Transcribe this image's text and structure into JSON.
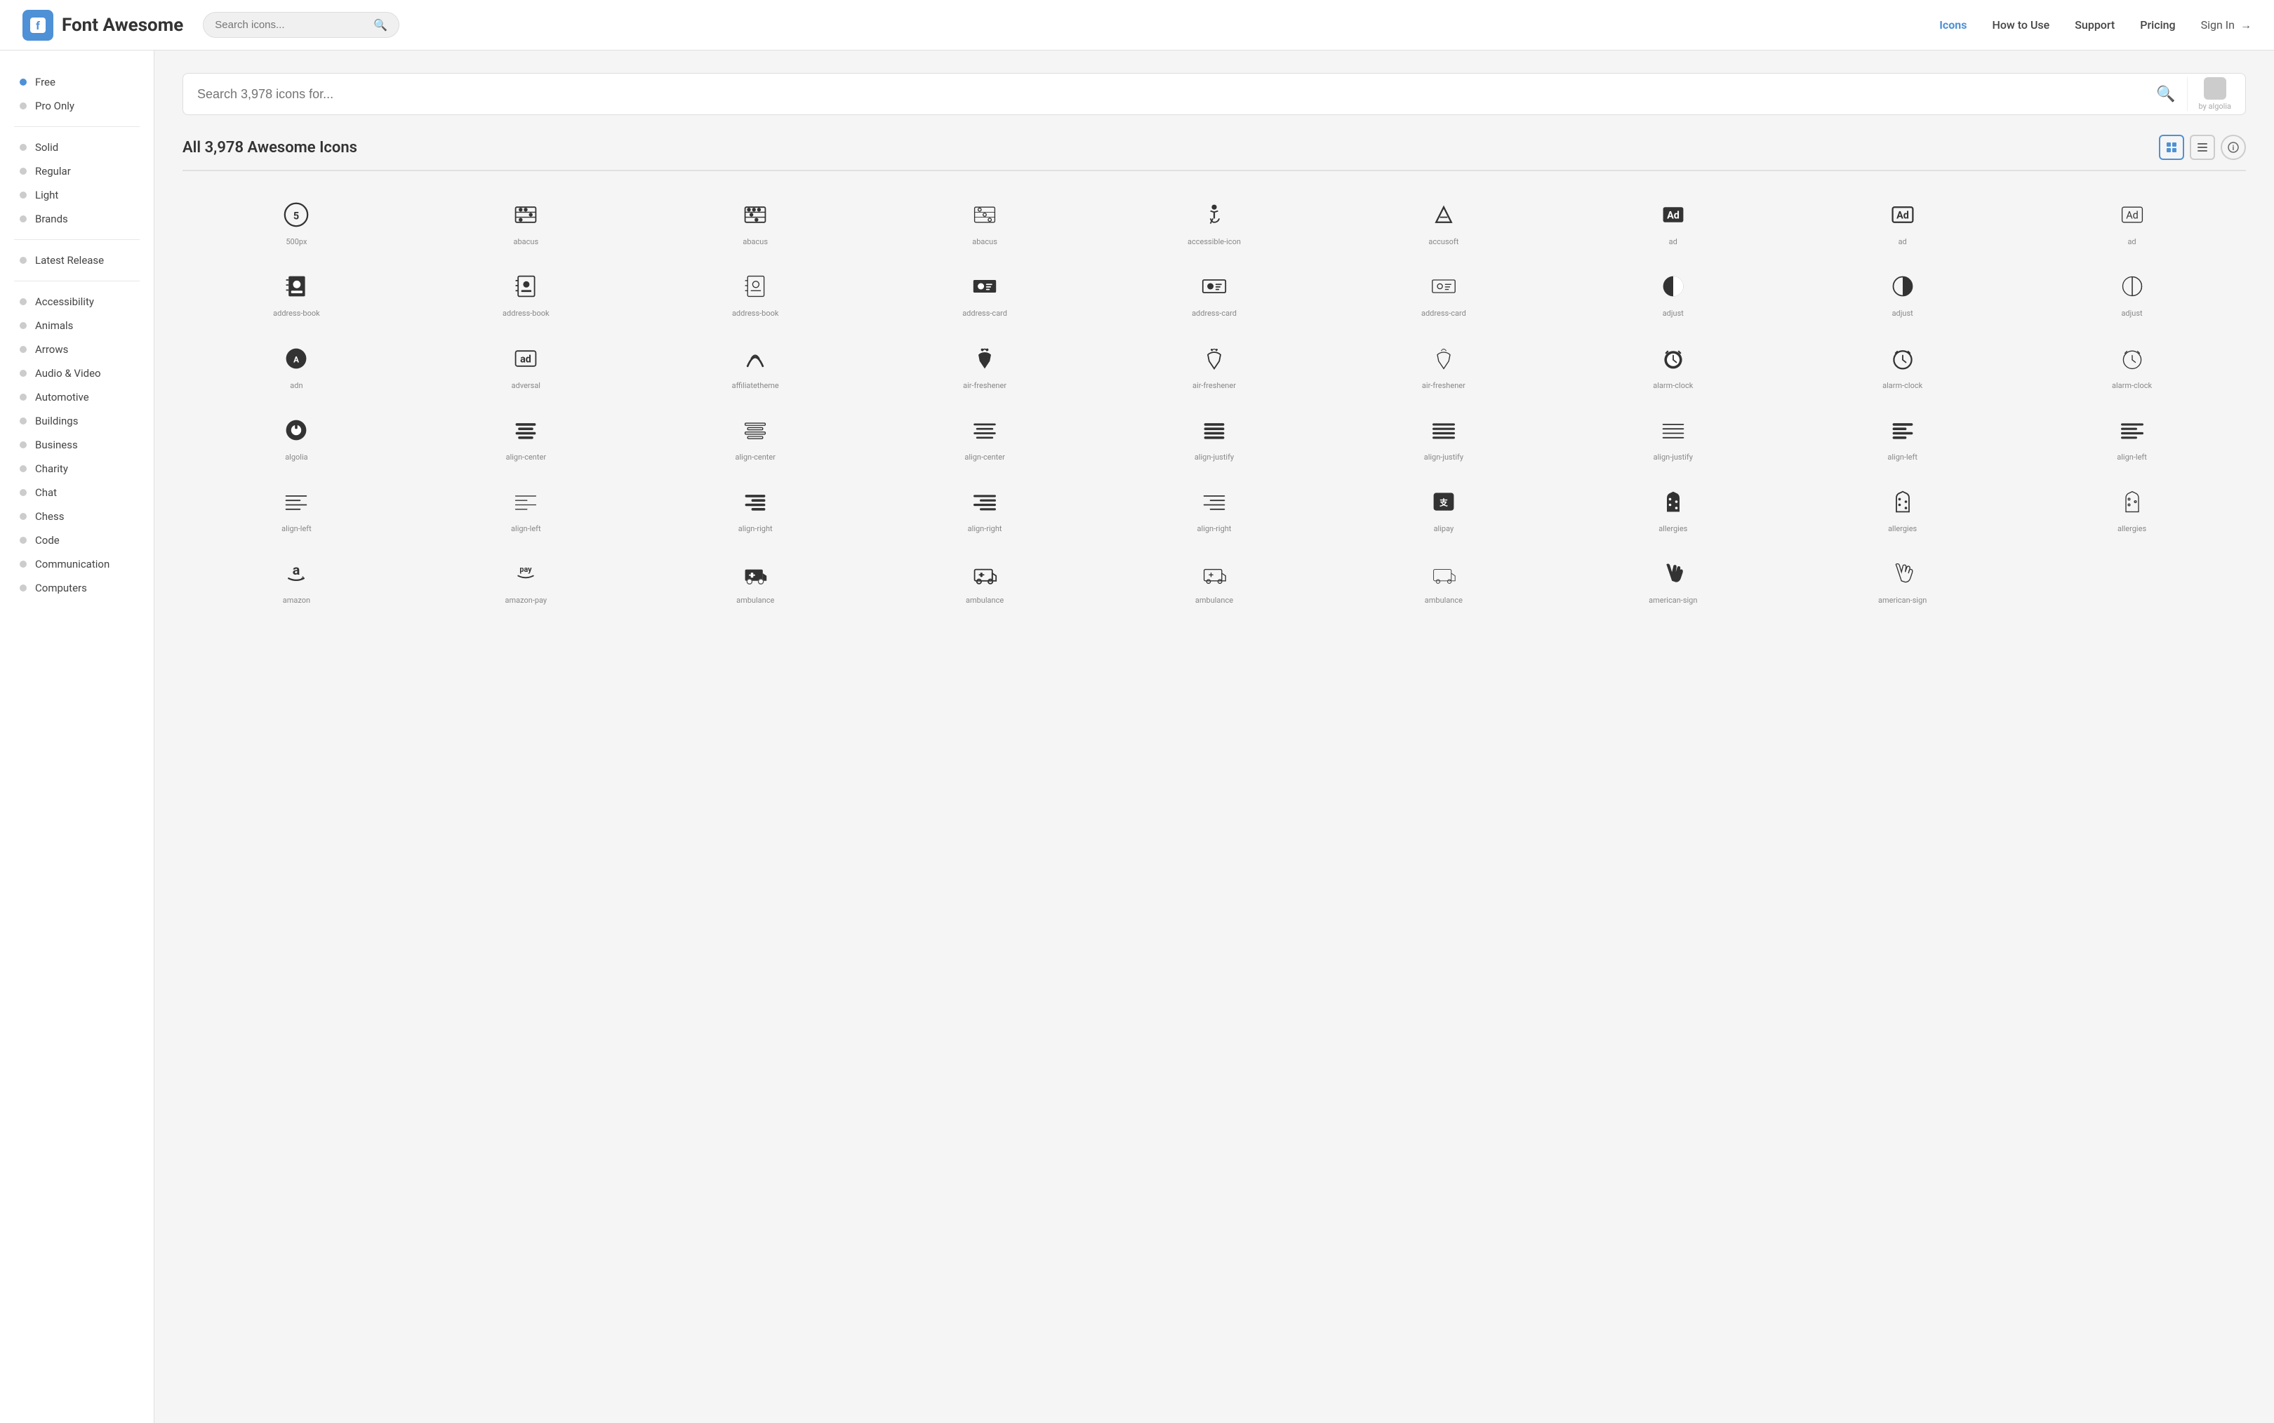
{
  "header": {
    "logo_text": "Font Awesome",
    "search_placeholder": "Search icons...",
    "nav": [
      {
        "label": "Icons",
        "active": true
      },
      {
        "label": "How to Use",
        "active": false
      },
      {
        "label": "Support",
        "active": false
      },
      {
        "label": "Pricing",
        "active": false
      }
    ],
    "sign_in": "Sign In"
  },
  "sidebar": {
    "filter_section": [
      {
        "label": "Free",
        "dot": "blue"
      },
      {
        "label": "Pro Only",
        "dot": "default"
      }
    ],
    "style_section": [
      {
        "label": "Solid",
        "dot": "default"
      },
      {
        "label": "Regular",
        "dot": "default"
      },
      {
        "label": "Light",
        "dot": "default"
      },
      {
        "label": "Brands",
        "dot": "default"
      }
    ],
    "special_section": [
      {
        "label": "Latest Release",
        "dot": "default"
      }
    ],
    "category_section": [
      {
        "label": "Accessibility"
      },
      {
        "label": "Animals"
      },
      {
        "label": "Arrows"
      },
      {
        "label": "Audio & Video"
      },
      {
        "label": "Automotive"
      },
      {
        "label": "Buildings"
      },
      {
        "label": "Business"
      },
      {
        "label": "Charity"
      },
      {
        "label": "Chat"
      },
      {
        "label": "Chess"
      },
      {
        "label": "Code"
      },
      {
        "label": "Communication"
      },
      {
        "label": "Computers"
      }
    ]
  },
  "main": {
    "search_placeholder": "Search 3,978 icons for...",
    "algolia_label": "by algolia",
    "icons_title": "All 3,978 Awesome Icons",
    "icons": [
      {
        "label": "500px",
        "symbol": "⑤"
      },
      {
        "label": "abacus",
        "symbol": "abacus1"
      },
      {
        "label": "abacus",
        "symbol": "abacus2"
      },
      {
        "label": "abacus",
        "symbol": "abacus3"
      },
      {
        "label": "accessible-icon",
        "symbol": "accessible"
      },
      {
        "label": "accusoft",
        "symbol": "accusoft"
      },
      {
        "label": "ad",
        "symbol": "ad1"
      },
      {
        "label": "ad",
        "symbol": "ad2"
      },
      {
        "label": "ad",
        "symbol": "ad3"
      },
      {
        "label": "address-book",
        "symbol": "addrbook1"
      },
      {
        "label": "address-book",
        "symbol": "addrbook2"
      },
      {
        "label": "address-book",
        "symbol": "addrbook3"
      },
      {
        "label": "address-card",
        "symbol": "addrcard1"
      },
      {
        "label": "address-card",
        "symbol": "addrcard2"
      },
      {
        "label": "address-card",
        "symbol": "addrcard3"
      },
      {
        "label": "adjust",
        "symbol": "adjust1"
      },
      {
        "label": "adjust",
        "symbol": "adjust2"
      },
      {
        "label": "adjust",
        "symbol": "adjust3"
      },
      {
        "label": "adn",
        "symbol": "adn"
      },
      {
        "label": "adversal",
        "symbol": "adversal"
      },
      {
        "label": "affiliatetheme",
        "symbol": "affiliate"
      },
      {
        "label": "air-freshener",
        "symbol": "airfresh1"
      },
      {
        "label": "air-freshener",
        "symbol": "airfresh2"
      },
      {
        "label": "air-freshener",
        "symbol": "airfresh3"
      },
      {
        "label": "alarm-clock",
        "symbol": "alarm1"
      },
      {
        "label": "alarm-clock",
        "symbol": "alarm2"
      },
      {
        "label": "alarm-clock",
        "symbol": "alarm3"
      },
      {
        "label": "algolia",
        "symbol": "algolia"
      },
      {
        "label": "align-center",
        "symbol": "aligncenter1"
      },
      {
        "label": "align-center",
        "symbol": "aligncenter2"
      },
      {
        "label": "align-center",
        "symbol": "aligncenter3"
      },
      {
        "label": "align-justify",
        "symbol": "alignjustify1"
      },
      {
        "label": "align-justify",
        "symbol": "alignjustify2"
      },
      {
        "label": "align-justify",
        "symbol": "alignjustify3"
      },
      {
        "label": "align-left",
        "symbol": "alignleft1"
      },
      {
        "label": "align-left",
        "symbol": "alignleft2"
      },
      {
        "label": "align-left",
        "symbol": "alignleft3"
      },
      {
        "label": "align-left",
        "symbol": "alignleft4"
      },
      {
        "label": "align-right",
        "symbol": "alignright1"
      },
      {
        "label": "align-right",
        "symbol": "alignright2"
      },
      {
        "label": "align-right",
        "symbol": "alignright3"
      },
      {
        "label": "alipay",
        "symbol": "alipay"
      },
      {
        "label": "allergies",
        "symbol": "allergies1"
      },
      {
        "label": "allergies",
        "symbol": "allergies2"
      },
      {
        "label": "allergies",
        "symbol": "allergies3"
      },
      {
        "label": "amazon",
        "symbol": "amazon"
      },
      {
        "label": "amazon-pay",
        "symbol": "amazonpay"
      },
      {
        "label": "ambulance",
        "symbol": "ambulance1"
      },
      {
        "label": "ambulance",
        "symbol": "ambulance2"
      },
      {
        "label": "ambulance",
        "symbol": "ambulance3"
      },
      {
        "label": "ambulance",
        "symbol": "ambulance4"
      },
      {
        "label": "american-sign",
        "symbol": "asl1"
      },
      {
        "label": "american-sign",
        "symbol": "asl2"
      }
    ]
  }
}
